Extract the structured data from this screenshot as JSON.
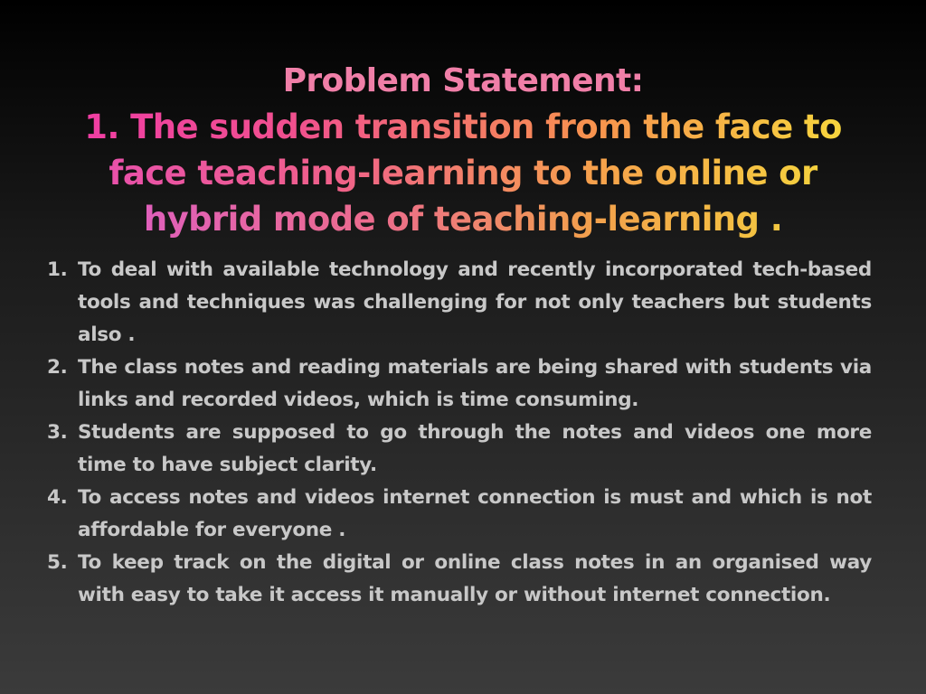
{
  "title": {
    "heading": "Problem Statement:",
    "line1": "1. The sudden transition from the face to",
    "line2": "face teaching-learning to the online or",
    "line3": "hybrid mode of teaching-learning ."
  },
  "points": [
    {
      "number": "1.",
      "text": "To deal with available technology and recently incorporated tech-based tools and techniques was challenging for not only teachers but students also ."
    },
    {
      "number": "2.",
      "text": "The class notes and reading materials are being shared with students via links and recorded videos, which is time consuming."
    },
    {
      "number": "3.",
      "text": "Students are supposed to go through the notes and videos one more time to have subject clarity."
    },
    {
      "number": "4.",
      "text": "To access notes and videos internet connection is must and which is not affordable for everyone ."
    },
    {
      "number": "5.",
      "text": "To keep track on the digital or online class notes in an organised way with easy to take it access it manually or without internet connection."
    }
  ],
  "colors": {
    "background_top": "#000000",
    "background_bottom": "#3b3b3b",
    "heading": "#f07fa8",
    "gradient_start": "#f03aa8",
    "gradient_end": "#f7e23a",
    "body_text": "#c8c8c8"
  }
}
